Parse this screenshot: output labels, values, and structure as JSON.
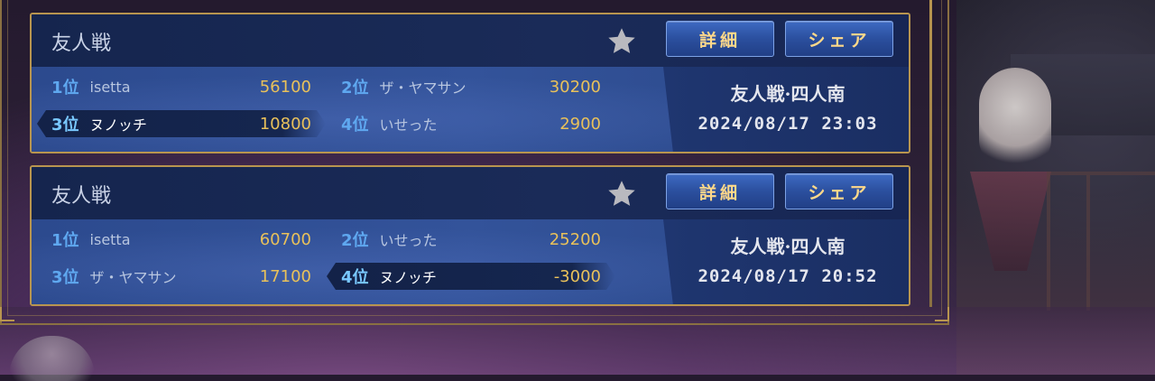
{
  "records": [
    {
      "title": "友人戦",
      "details_label": "詳細",
      "share_label": "シェア",
      "game_type": "友人戦·四人南",
      "datetime": "2024/08/17 23:03",
      "players": [
        {
          "rank": "1位",
          "name": "isetta",
          "score": "56100"
        },
        {
          "rank": "2位",
          "name": "ザ・ヤマサン",
          "score": "30200"
        },
        {
          "rank": "3位",
          "name": "ヌノッチ",
          "score": "10800"
        },
        {
          "rank": "4位",
          "name": "いせった",
          "score": "2900"
        }
      ]
    },
    {
      "title": "友人戦",
      "details_label": "詳細",
      "share_label": "シェア",
      "game_type": "友人戦·四人南",
      "datetime": "2024/08/17 20:52",
      "players": [
        {
          "rank": "1位",
          "name": "isetta",
          "score": "60700"
        },
        {
          "rank": "2位",
          "name": "いせった",
          "score": "25200"
        },
        {
          "rank": "3位",
          "name": "ザ・ヤマサン",
          "score": "17100"
        },
        {
          "rank": "4位",
          "name": "ヌノッチ",
          "score": "-3000"
        }
      ]
    }
  ],
  "icons": {
    "favorite": "star-icon"
  },
  "colors": {
    "accent_gold": "#e9c15a",
    "frame_gold": "#b8954f",
    "rank_blue": "#5fa8f0",
    "button_text": "#ffd98a"
  }
}
